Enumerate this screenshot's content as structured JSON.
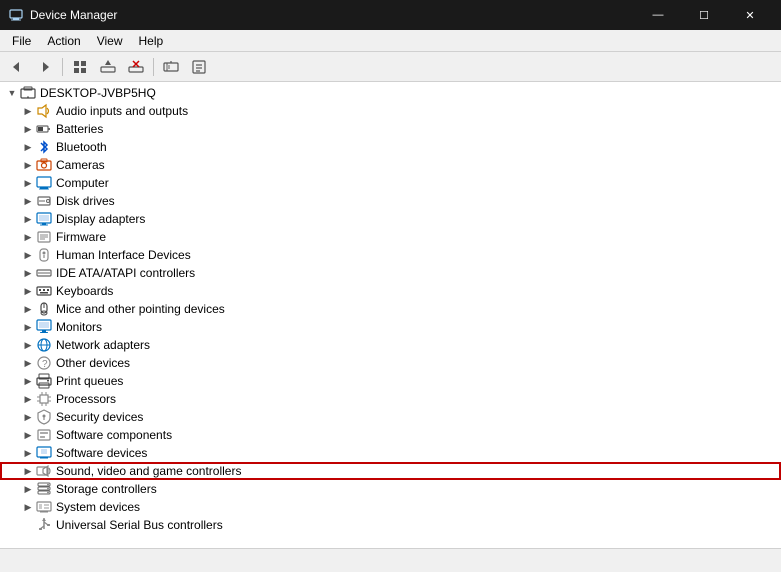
{
  "titleBar": {
    "title": "Device Manager",
    "iconSymbol": "🖥",
    "minimizeLabel": "—",
    "maximizeLabel": "☐",
    "closeLabel": "✕"
  },
  "menuBar": {
    "items": [
      {
        "id": "file",
        "label": "File"
      },
      {
        "id": "action",
        "label": "Action"
      },
      {
        "id": "view",
        "label": "View"
      },
      {
        "id": "help",
        "label": "Help"
      }
    ]
  },
  "toolbar": {
    "buttons": [
      {
        "id": "back",
        "symbol": "←",
        "tooltip": "Back"
      },
      {
        "id": "forward",
        "symbol": "→",
        "tooltip": "Forward"
      },
      {
        "id": "show-hide",
        "symbol": "▦",
        "tooltip": "Show/Hide"
      },
      {
        "id": "update-driver",
        "symbol": "⬆",
        "tooltip": "Update Driver"
      },
      {
        "id": "uninstall",
        "symbol": "✕",
        "tooltip": "Uninstall"
      },
      {
        "id": "scan",
        "symbol": "🔍",
        "tooltip": "Scan for hardware changes"
      },
      {
        "id": "properties",
        "symbol": "☰",
        "tooltip": "Properties"
      }
    ]
  },
  "tree": {
    "rootItem": {
      "label": "DESKTOP-JVBP5HQ",
      "expanded": true,
      "indent": 0
    },
    "items": [
      {
        "id": "audio",
        "label": "Audio inputs and outputs",
        "icon": "🔊",
        "indent": 1,
        "hasChildren": true,
        "expanded": false,
        "highlighted": false
      },
      {
        "id": "batteries",
        "label": "Batteries",
        "icon": "🔋",
        "indent": 1,
        "hasChildren": true,
        "expanded": false,
        "highlighted": false
      },
      {
        "id": "bluetooth",
        "label": "Bluetooth",
        "icon": "⬡",
        "indent": 1,
        "hasChildren": true,
        "expanded": false,
        "highlighted": false
      },
      {
        "id": "cameras",
        "label": "Cameras",
        "icon": "📷",
        "indent": 1,
        "hasChildren": true,
        "expanded": false,
        "highlighted": false
      },
      {
        "id": "computer",
        "label": "Computer",
        "icon": "💻",
        "indent": 1,
        "hasChildren": true,
        "expanded": false,
        "highlighted": false
      },
      {
        "id": "disk-drives",
        "label": "Disk drives",
        "icon": "💾",
        "indent": 1,
        "hasChildren": true,
        "expanded": false,
        "highlighted": false
      },
      {
        "id": "display-adapters",
        "label": "Display adapters",
        "icon": "🖥",
        "indent": 1,
        "hasChildren": true,
        "expanded": false,
        "highlighted": false
      },
      {
        "id": "firmware",
        "label": "Firmware",
        "icon": "📄",
        "indent": 1,
        "hasChildren": true,
        "expanded": false,
        "highlighted": false
      },
      {
        "id": "hid",
        "label": "Human Interface Devices",
        "icon": "🎮",
        "indent": 1,
        "hasChildren": true,
        "expanded": false,
        "highlighted": false
      },
      {
        "id": "ide",
        "label": "IDE ATA/ATAPI controllers",
        "icon": "🔌",
        "indent": 1,
        "hasChildren": true,
        "expanded": false,
        "highlighted": false
      },
      {
        "id": "keyboards",
        "label": "Keyboards",
        "icon": "⌨",
        "indent": 1,
        "hasChildren": true,
        "expanded": false,
        "highlighted": false
      },
      {
        "id": "mice",
        "label": "Mice and other pointing devices",
        "icon": "🖱",
        "indent": 1,
        "hasChildren": true,
        "expanded": false,
        "highlighted": false
      },
      {
        "id": "monitors",
        "label": "Monitors",
        "icon": "🖥",
        "indent": 1,
        "hasChildren": true,
        "expanded": false,
        "highlighted": false
      },
      {
        "id": "network",
        "label": "Network adapters",
        "icon": "🌐",
        "indent": 1,
        "hasChildren": true,
        "expanded": false,
        "highlighted": false
      },
      {
        "id": "other",
        "label": "Other devices",
        "icon": "❓",
        "indent": 1,
        "hasChildren": true,
        "expanded": false,
        "highlighted": false
      },
      {
        "id": "print",
        "label": "Print queues",
        "icon": "🖨",
        "indent": 1,
        "hasChildren": true,
        "expanded": false,
        "highlighted": false
      },
      {
        "id": "processors",
        "label": "Processors",
        "icon": "⚙",
        "indent": 1,
        "hasChildren": true,
        "expanded": false,
        "highlighted": false
      },
      {
        "id": "security",
        "label": "Security devices",
        "icon": "🔒",
        "indent": 1,
        "hasChildren": true,
        "expanded": false,
        "highlighted": false
      },
      {
        "id": "software-components",
        "label": "Software components",
        "icon": "📦",
        "indent": 1,
        "hasChildren": true,
        "expanded": false,
        "highlighted": false
      },
      {
        "id": "software-devices",
        "label": "Software devices",
        "icon": "🖥",
        "indent": 1,
        "hasChildren": true,
        "expanded": false,
        "highlighted": false
      },
      {
        "id": "sound",
        "label": "Sound, video and game controllers",
        "icon": "🔉",
        "indent": 1,
        "hasChildren": true,
        "expanded": false,
        "highlighted": true
      },
      {
        "id": "storage",
        "label": "Storage controllers",
        "icon": "💽",
        "indent": 1,
        "hasChildren": true,
        "expanded": false,
        "highlighted": false
      },
      {
        "id": "system-devices",
        "label": "System devices",
        "icon": "🖥",
        "indent": 1,
        "hasChildren": true,
        "expanded": false,
        "highlighted": false
      },
      {
        "id": "usb",
        "label": "Universal Serial Bus controllers",
        "icon": "🔌",
        "indent": 1,
        "hasChildren": false,
        "expanded": false,
        "highlighted": false
      }
    ]
  },
  "statusBar": {
    "text": ""
  }
}
